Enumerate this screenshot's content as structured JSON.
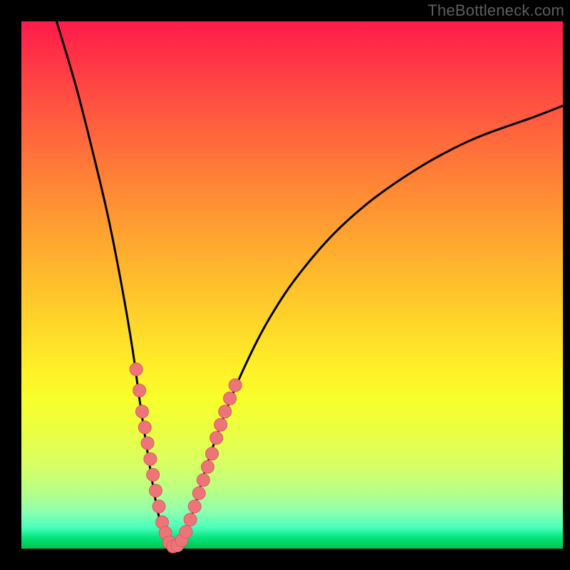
{
  "watermark": "TheBottleneck.com",
  "colors": {
    "background_frame": "#000000",
    "curve_stroke": "#000000",
    "marker_fill": "#ed7579",
    "marker_stroke": "#d95a60"
  },
  "chart_data": {
    "type": "line",
    "title": "",
    "xlabel": "",
    "ylabel": "",
    "xlim": [
      0,
      100
    ],
    "ylim": [
      0,
      100
    ],
    "grid": false,
    "left_curve": [
      {
        "x": 6.5,
        "y": 100
      },
      {
        "x": 10,
        "y": 88
      },
      {
        "x": 13,
        "y": 76
      },
      {
        "x": 16,
        "y": 63
      },
      {
        "x": 18.5,
        "y": 50
      },
      {
        "x": 20.5,
        "y": 38
      },
      {
        "x": 22,
        "y": 27
      },
      {
        "x": 23.5,
        "y": 17
      },
      {
        "x": 25,
        "y": 8
      },
      {
        "x": 26.5,
        "y": 2
      },
      {
        "x": 28,
        "y": 0
      }
    ],
    "right_curve": [
      {
        "x": 28,
        "y": 0
      },
      {
        "x": 30,
        "y": 2
      },
      {
        "x": 32,
        "y": 8
      },
      {
        "x": 34,
        "y": 15
      },
      {
        "x": 37,
        "y": 24
      },
      {
        "x": 41,
        "y": 34
      },
      {
        "x": 46,
        "y": 44
      },
      {
        "x": 52,
        "y": 53
      },
      {
        "x": 60,
        "y": 62
      },
      {
        "x": 70,
        "y": 70
      },
      {
        "x": 82,
        "y": 77
      },
      {
        "x": 95,
        "y": 82
      },
      {
        "x": 100,
        "y": 84
      }
    ],
    "markers": [
      {
        "x": 21.2,
        "y": 34
      },
      {
        "x": 21.8,
        "y": 30
      },
      {
        "x": 22.3,
        "y": 26
      },
      {
        "x": 22.8,
        "y": 23
      },
      {
        "x": 23.3,
        "y": 20
      },
      {
        "x": 23.8,
        "y": 17
      },
      {
        "x": 24.3,
        "y": 14
      },
      {
        "x": 24.8,
        "y": 11
      },
      {
        "x": 25.4,
        "y": 8
      },
      {
        "x": 26.0,
        "y": 5
      },
      {
        "x": 26.6,
        "y": 3
      },
      {
        "x": 27.3,
        "y": 1.2
      },
      {
        "x": 28.0,
        "y": 0.4
      },
      {
        "x": 28.8,
        "y": 0.6
      },
      {
        "x": 29.6,
        "y": 1.6
      },
      {
        "x": 30.4,
        "y": 3.2
      },
      {
        "x": 31.2,
        "y": 5.5
      },
      {
        "x": 32.0,
        "y": 8
      },
      {
        "x": 32.8,
        "y": 10.5
      },
      {
        "x": 33.6,
        "y": 13
      },
      {
        "x": 34.4,
        "y": 15.5
      },
      {
        "x": 35.2,
        "y": 18
      },
      {
        "x": 36.0,
        "y": 21
      },
      {
        "x": 36.8,
        "y": 23.5
      },
      {
        "x": 37.6,
        "y": 26
      },
      {
        "x": 38.5,
        "y": 28.5
      },
      {
        "x": 39.5,
        "y": 31
      }
    ]
  }
}
